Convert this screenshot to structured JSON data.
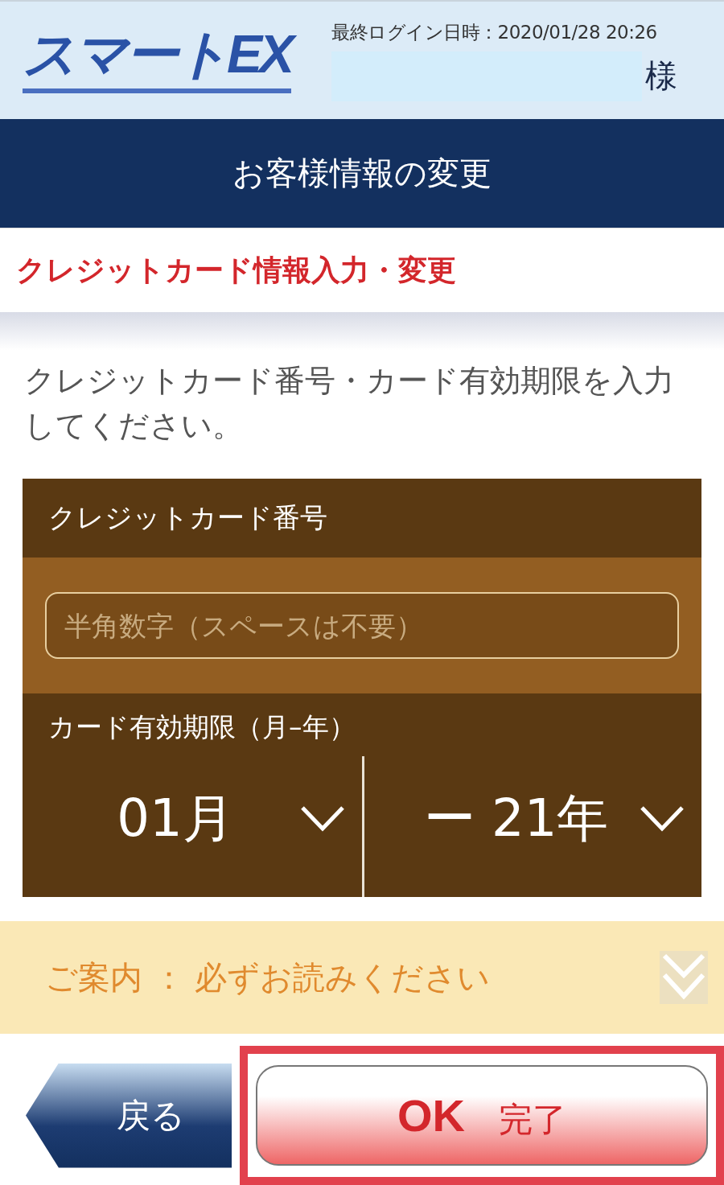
{
  "header": {
    "logo": "スマートEX",
    "last_login": "最終ログイン日時：2020/01/28 20:26",
    "honorific": "様"
  },
  "title_bar": {
    "title": "お客様情報の変更"
  },
  "section": {
    "heading": "クレジットカード情報入力・変更"
  },
  "instruction": "クレジットカード番号・カード有効期限を入力してください。",
  "card_form": {
    "number_label": "クレジットカード番号",
    "number_field": {
      "placeholder": "半角数字（スペースは不要）"
    },
    "expiry_label": "カード有効期限（月–年）",
    "expiry_selects": [
      {
        "value": "01月"
      },
      {
        "value": "ー 21年"
      }
    ]
  },
  "notice": {
    "label": "ご案内 ： 必ずお読みください",
    "expanded": false
  },
  "buttons": [
    {
      "kind": "back",
      "label": "戻る",
      "highlighted": false
    },
    {
      "kind": "ok",
      "label": "**OK**　完了",
      "highlighted": true
    }
  ]
}
